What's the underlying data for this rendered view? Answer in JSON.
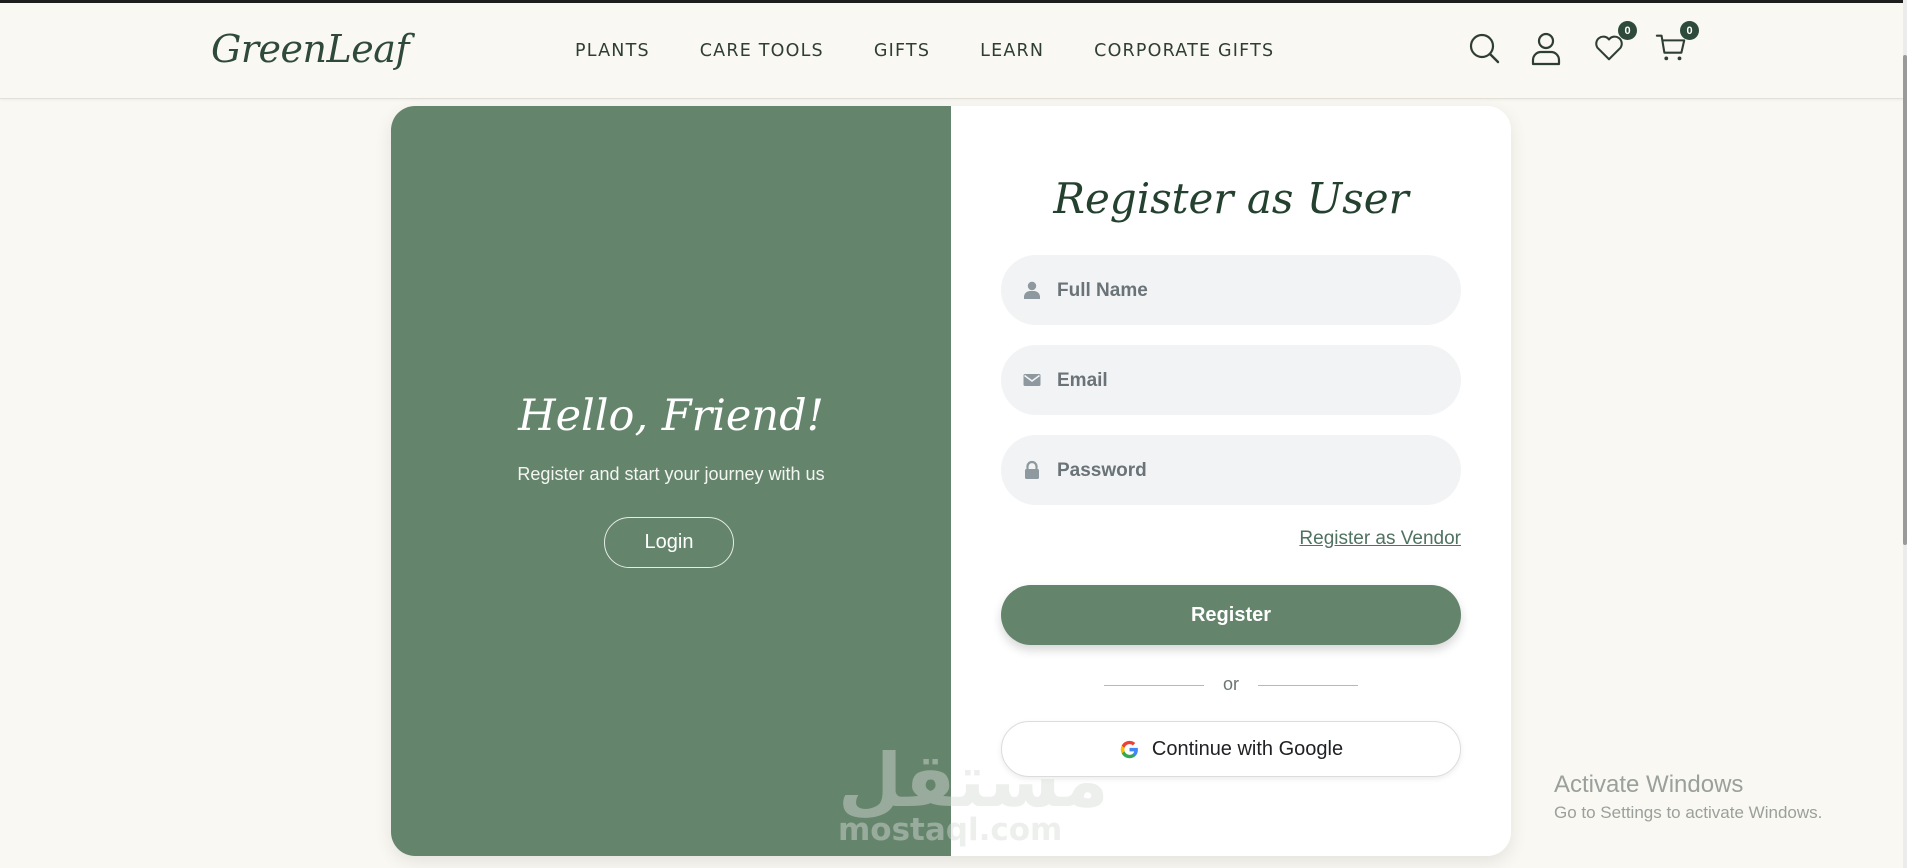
{
  "brand": {
    "name": "GreenLeaf"
  },
  "nav": {
    "items": [
      {
        "label": "PLANTS"
      },
      {
        "label": "CARE TOOLS"
      },
      {
        "label": "GIFTS"
      },
      {
        "label": "LEARN"
      },
      {
        "label": "CORPORATE GIFTS"
      }
    ]
  },
  "header_icons": {
    "search": "search-icon",
    "account": "user-icon",
    "wishlist": {
      "icon": "heart-icon",
      "count": "0"
    },
    "cart": {
      "icon": "cart-icon",
      "count": "0"
    }
  },
  "left_panel": {
    "heading": "Hello, Friend!",
    "subtitle": "Register and start your journey with us",
    "login_label": "Login"
  },
  "form": {
    "title": "Register as User",
    "full_name": {
      "placeholder": "Full Name",
      "value": "",
      "icon": "user-icon"
    },
    "email": {
      "placeholder": "Email",
      "value": "",
      "icon": "mail-icon"
    },
    "password": {
      "placeholder": "Password",
      "value": "",
      "icon": "lock-icon"
    },
    "vendor_link": "Register as Vendor",
    "register_label": "Register",
    "divider_text": "or",
    "google_label": "Continue with Google"
  },
  "watermark": {
    "arabic": "مستقل",
    "latin": "mostaql.com"
  },
  "os_notice": {
    "title": "Activate Windows",
    "subtitle": "Go to Settings to activate Windows."
  },
  "colors": {
    "brand_green": "#64846c",
    "dark_green": "#2d4a3a",
    "page_background": "#faf8f2"
  }
}
